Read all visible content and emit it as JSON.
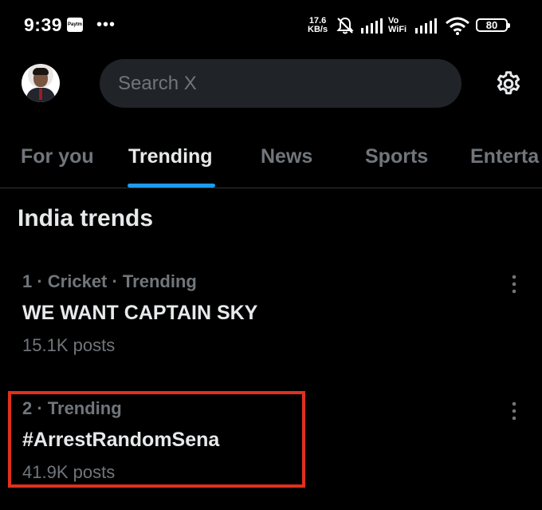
{
  "status_bar": {
    "time": "9:39",
    "paytm_icon_text": "Paytm",
    "net_speed_value": "17.6",
    "net_speed_unit": "KB/s",
    "vowifi_top": "Vo",
    "vowifi_bottom": "WiFi",
    "battery": "80"
  },
  "header": {
    "search_placeholder": "Search X"
  },
  "tabs": [
    {
      "label": "For you",
      "active": false
    },
    {
      "label": "Trending",
      "active": true
    },
    {
      "label": "News",
      "active": false
    },
    {
      "label": "Sports",
      "active": false
    },
    {
      "label": "Enterta",
      "active": false
    }
  ],
  "section": {
    "title": "India trends"
  },
  "trends": [
    {
      "meta": "1 · Cricket · Trending",
      "name": "WE WANT CAPTAIN SKY",
      "count": "15.1K posts"
    },
    {
      "meta": "2 · Trending",
      "name": "#ArrestRandomSena",
      "count": "41.9K posts"
    }
  ],
  "colors": {
    "background": "#000000",
    "accent": "#1d9bf0",
    "highlight": "#e0301e",
    "secondary_text": "#71767b"
  }
}
